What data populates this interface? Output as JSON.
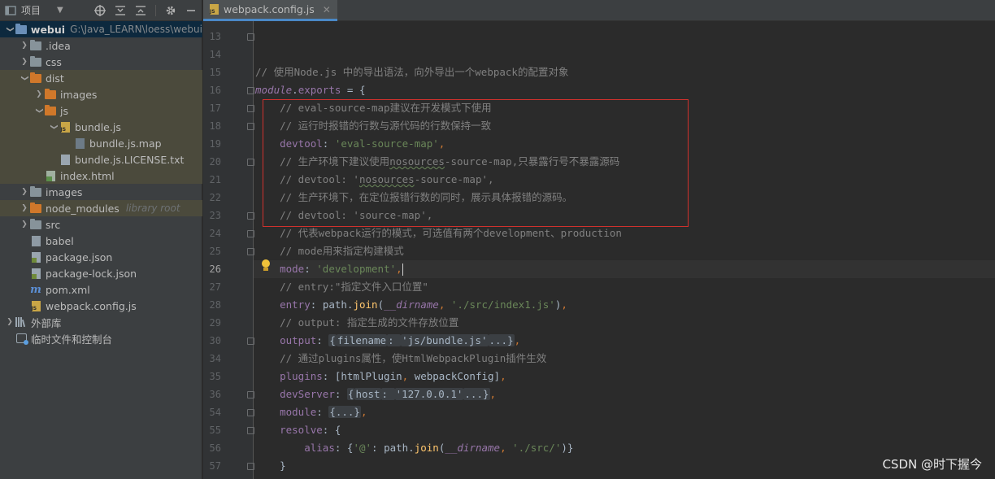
{
  "panel": {
    "title": "项目"
  },
  "tree": [
    {
      "label": "webui",
      "note": "G:\\Java_LEARN\\loess\\webui",
      "arrow": "▾",
      "icon": "folder-blue",
      "indent": 0,
      "bold": true,
      "state": "sel"
    },
    {
      "label": ".idea",
      "arrow": "›",
      "icon": "folder",
      "indent": 1
    },
    {
      "label": "css",
      "arrow": "›",
      "icon": "folder",
      "indent": 1
    },
    {
      "label": "dist",
      "arrow": "▾",
      "icon": "folder-orange",
      "indent": 1,
      "state": "hl"
    },
    {
      "label": "images",
      "arrow": "›",
      "icon": "folder-orange",
      "indent": 2,
      "state": "hl"
    },
    {
      "label": "js",
      "arrow": "▾",
      "icon": "folder-orange",
      "indent": 2,
      "state": "hl"
    },
    {
      "label": "bundle.js",
      "arrow": "▾",
      "icon": "file-js",
      "indent": 3,
      "state": "hl"
    },
    {
      "label": "bundle.js.map",
      "arrow": "",
      "icon": "file-map",
      "indent": 4,
      "state": "hl"
    },
    {
      "label": "bundle.js.LICENSE.txt",
      "arrow": "",
      "icon": "file-txt",
      "indent": 3,
      "state": "hl"
    },
    {
      "label": "index.html",
      "arrow": "",
      "icon": "file-html",
      "indent": 2,
      "state": "hl"
    },
    {
      "label": "images",
      "arrow": "›",
      "icon": "folder",
      "indent": 1
    },
    {
      "label": "node_modules",
      "note": "library root",
      "arrow": "›",
      "icon": "folder-orange",
      "indent": 1,
      "state": "hl"
    },
    {
      "label": "src",
      "arrow": "›",
      "icon": "folder",
      "indent": 1
    },
    {
      "label": "babel",
      "arrow": "",
      "icon": "file",
      "indent": 1
    },
    {
      "label": "package.json",
      "arrow": "",
      "icon": "file-json",
      "indent": 1
    },
    {
      "label": "package-lock.json",
      "arrow": "",
      "icon": "file-json",
      "indent": 1
    },
    {
      "label": "pom.xml",
      "arrow": "",
      "icon": "maven",
      "indent": 1
    },
    {
      "label": "webpack.config.js",
      "arrow": "",
      "icon": "file-js",
      "indent": 1
    },
    {
      "label": "外部库",
      "arrow": "›",
      "icon": "library",
      "indent": 0
    },
    {
      "label": "临时文件和控制台",
      "arrow": "",
      "icon": "scratch",
      "indent": 0
    }
  ],
  "tab": {
    "label": "webpack.config.js"
  },
  "code": [
    {
      "ln": "13",
      "tokens": [
        [
          "c",
          ""
        ]
      ],
      "fold": true
    },
    {
      "ln": "14",
      "tokens": []
    },
    {
      "ln": "15",
      "tokens": [
        [
          "c",
          "// 使用Node.js 中的导出语法，向外导出一个webpack的配置对象"
        ]
      ]
    },
    {
      "ln": "16",
      "tokens": [
        [
          "mod",
          "module"
        ],
        [
          "",
          "."
        ],
        [
          "prop",
          "exports"
        ],
        [
          "",
          " = {"
        ]
      ],
      "fold": true
    },
    {
      "ln": "17",
      "tokens": [
        [
          "",
          "    "
        ],
        [
          "c",
          "// eval-source-map建议在开发模式下使用"
        ]
      ],
      "fold": true
    },
    {
      "ln": "18",
      "tokens": [
        [
          "",
          "    "
        ],
        [
          "c",
          "// 运行时报错的行数与源代码的行数保持一致"
        ]
      ],
      "fold": true
    },
    {
      "ln": "19",
      "tokens": [
        [
          "",
          "    "
        ],
        [
          "prop",
          "devtool"
        ],
        [
          "",
          ": "
        ],
        [
          "str",
          "'eval-source-map'"
        ],
        [
          "kw",
          ","
        ]
      ]
    },
    {
      "ln": "20",
      "tokens": [
        [
          "",
          "    "
        ],
        [
          "c",
          "// 生产环境下建议使用"
        ],
        [
          "cw",
          "nosources"
        ],
        [
          "c",
          "-source-map,只暴露行号不暴露源码"
        ]
      ],
      "fold": true
    },
    {
      "ln": "21",
      "tokens": [
        [
          "",
          "    "
        ],
        [
          "c",
          "// devtool: '"
        ],
        [
          "cw",
          "nosources"
        ],
        [
          "c",
          "-source-map',"
        ]
      ]
    },
    {
      "ln": "22",
      "tokens": [
        [
          "",
          "    "
        ],
        [
          "c",
          "// 生产环境下，在定位报错行数的同时，展示具体报错的源码。"
        ]
      ]
    },
    {
      "ln": "23",
      "tokens": [
        [
          "",
          "    "
        ],
        [
          "c",
          "// devtool: 'source-map',"
        ]
      ],
      "fold": true
    },
    {
      "ln": "24",
      "tokens": [
        [
          "",
          "    "
        ],
        [
          "c",
          "// 代表webpack运行的模式，可选值有两个development、production"
        ]
      ],
      "fold": true
    },
    {
      "ln": "25",
      "tokens": [
        [
          "",
          "    "
        ],
        [
          "c",
          "// mode用来指定构建模式"
        ]
      ],
      "fold": true
    },
    {
      "ln": "26",
      "tokens": [
        [
          "",
          "    "
        ],
        [
          "prop",
          "mode"
        ],
        [
          "",
          ": "
        ],
        [
          "str",
          "'development'"
        ],
        [
          "kw",
          ","
        ],
        [
          "caret",
          ""
        ]
      ],
      "current": true
    },
    {
      "ln": "27",
      "tokens": [
        [
          "",
          "    "
        ],
        [
          "c",
          "// entry:\"指定文件入口位置\""
        ]
      ]
    },
    {
      "ln": "28",
      "tokens": [
        [
          "",
          "    "
        ],
        [
          "prop",
          "entry"
        ],
        [
          "",
          ": "
        ],
        [
          "",
          "path."
        ],
        [
          "fn",
          "join"
        ],
        [
          "",
          "("
        ],
        [
          "ital",
          "__dirname"
        ],
        [
          "kw",
          ","
        ],
        [
          "",
          " "
        ],
        [
          "str",
          "'./src/index1.js'"
        ],
        [
          "",
          ")"
        ],
        [
          "kw",
          ","
        ]
      ]
    },
    {
      "ln": "29",
      "tokens": [
        [
          "",
          "    "
        ],
        [
          "c",
          "// output: 指定生成的文件存放位置"
        ]
      ]
    },
    {
      "ln": "30",
      "tokens": [
        [
          "",
          "    "
        ],
        [
          "prop",
          "output"
        ],
        [
          "",
          ": "
        ],
        [
          "fb",
          "{"
        ],
        [
          "prop-fb",
          "filename"
        ],
        [
          "fb",
          ": "
        ],
        [
          "str-fb",
          "'js/bundle.js'"
        ],
        [
          "fb",
          "...}"
        ],
        [
          "kw",
          ","
        ]
      ],
      "fold": true
    },
    {
      "ln": "34",
      "tokens": [
        [
          "",
          "    "
        ],
        [
          "c",
          "// 通过plugins属性，使HtmlWebpackPlugin插件生效"
        ]
      ]
    },
    {
      "ln": "35",
      "tokens": [
        [
          "",
          "    "
        ],
        [
          "prop",
          "plugins"
        ],
        [
          "",
          ": [htmlPlugin"
        ],
        [
          "kw",
          ","
        ],
        [
          "",
          " webpackConfig]"
        ],
        [
          "kw",
          ","
        ]
      ]
    },
    {
      "ln": "36",
      "tokens": [
        [
          "",
          "    "
        ],
        [
          "prop",
          "devServer"
        ],
        [
          "",
          ": "
        ],
        [
          "fb",
          "{"
        ],
        [
          "prop-fb",
          "host"
        ],
        [
          "fb",
          ": "
        ],
        [
          "str-fb",
          "'127.0.0.1'"
        ],
        [
          "fb",
          "...}"
        ],
        [
          "kw",
          ","
        ]
      ],
      "fold": true
    },
    {
      "ln": "54",
      "tokens": [
        [
          "",
          "    "
        ],
        [
          "prop",
          "module"
        ],
        [
          "",
          ": "
        ],
        [
          "fb",
          "{...}"
        ],
        [
          "kw",
          ","
        ]
      ],
      "fold": true
    },
    {
      "ln": "55",
      "tokens": [
        [
          "",
          "    "
        ],
        [
          "prop",
          "resolve"
        ],
        [
          "",
          ": {"
        ]
      ],
      "fold": true
    },
    {
      "ln": "56",
      "tokens": [
        [
          "",
          "        "
        ],
        [
          "prop",
          "alias"
        ],
        [
          "",
          ": {"
        ],
        [
          "str",
          "'@'"
        ],
        [
          "",
          ": path."
        ],
        [
          "fn",
          "join"
        ],
        [
          "",
          "("
        ],
        [
          "ital",
          "__dirname"
        ],
        [
          "kw",
          ","
        ],
        [
          "",
          " "
        ],
        [
          "str",
          "'./src/'"
        ],
        [
          "",
          ")}"
        ]
      ]
    },
    {
      "ln": "57",
      "tokens": [
        [
          "",
          "    }"
        ]
      ],
      "fold": true
    }
  ],
  "watermark": "CSDN @时下握今"
}
